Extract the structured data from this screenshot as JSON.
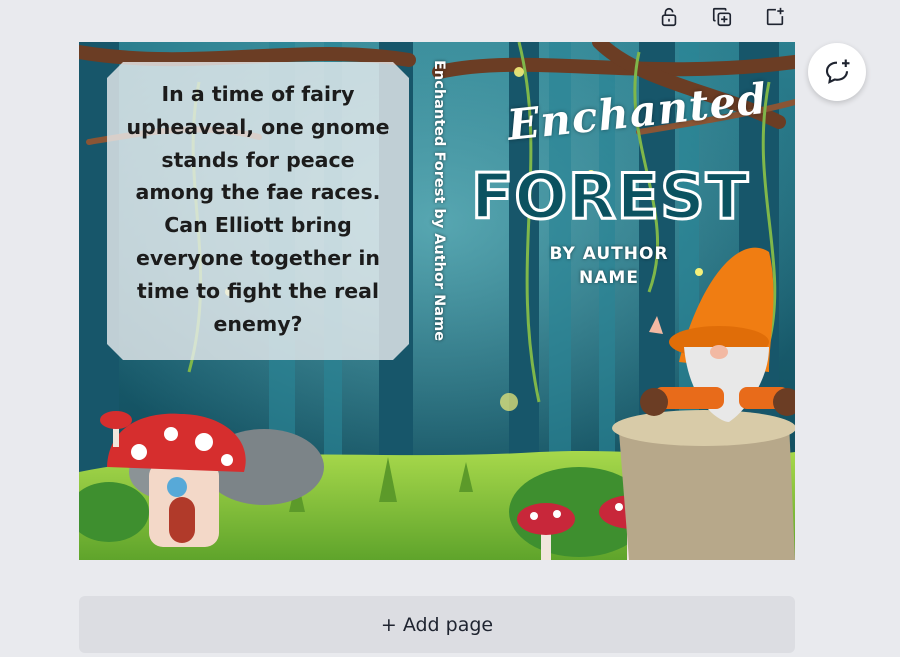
{
  "toolbar": {
    "icons": [
      "lock-icon",
      "duplicate-page-icon",
      "add-page-icon"
    ]
  },
  "comment_button": {
    "icon": "add-comment-icon"
  },
  "cover": {
    "blurb": "In a time of fairy upheaveal, one gnome stands for peace among the fae races. Can Elliott bring everyone together in time to fight the real enemy?",
    "spine_text": "Enchanted Forest    by Author Name",
    "title_script": "Enchanted",
    "title_main": "FOREST",
    "author_line": "BY AUTHOR NAME"
  },
  "add_page": {
    "label": "+ Add page"
  },
  "colors": {
    "app_bg": "#e9eaee",
    "forest_dark": "#0b3f4d",
    "forest_mid": "#1f6f80",
    "grass": "#8cc63f",
    "gnome_hat": "#f07d12",
    "mushroom_red": "#d62e2e"
  }
}
